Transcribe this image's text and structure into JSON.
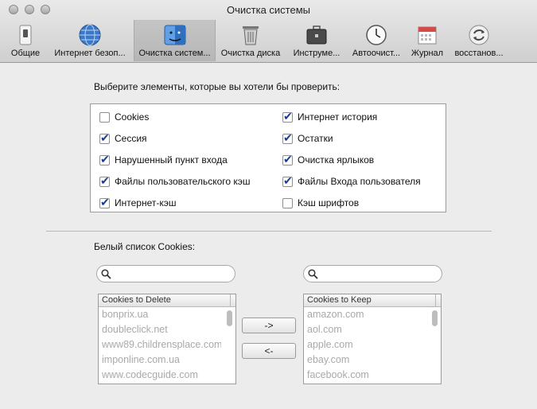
{
  "window": {
    "title": "Очистка системы"
  },
  "toolbar": {
    "items": [
      {
        "label": "Общие",
        "icon": "switch-icon"
      },
      {
        "label": "Интернет безоп...",
        "icon": "globe-icon"
      },
      {
        "label": "Очистка систем...",
        "icon": "finder-icon"
      },
      {
        "label": "Очистка диска",
        "icon": "trash-icon"
      },
      {
        "label": "Инструме...",
        "icon": "toolbox-icon"
      },
      {
        "label": "Автоочист...",
        "icon": "clock-icon"
      },
      {
        "label": "Журнал",
        "icon": "calendar-icon"
      },
      {
        "label": "восстанов...",
        "icon": "restore-icon"
      }
    ]
  },
  "selection": {
    "prompt": "Выберите элементы, которые вы хотели бы проверить:",
    "left": [
      {
        "label": "Cookies",
        "checked": false
      },
      {
        "label": "Сессия",
        "checked": true
      },
      {
        "label": "Нарушенный пункт входа",
        "checked": true
      },
      {
        "label": "Файлы пользовательского кэш",
        "checked": true
      },
      {
        "label": "Интернет-кэш",
        "checked": true
      }
    ],
    "right": [
      {
        "label": "Интернет история",
        "checked": true
      },
      {
        "label": "Остатки",
        "checked": true
      },
      {
        "label": "Очистка ярлыков",
        "checked": true
      },
      {
        "label": "Файлы Входа пользователя",
        "checked": true
      },
      {
        "label": "Кэш шрифтов",
        "checked": false
      }
    ]
  },
  "whitelist": {
    "label": "Белый список Cookies:",
    "delete_header": "Cookies to Delete",
    "keep_header": "Cookies to Keep",
    "delete_items": [
      "bonprix.ua",
      "doubleclick.net",
      "www89.childrensplace.com",
      "imponline.com.ua",
      "www.codecguide.com"
    ],
    "keep_items": [
      "amazon.com",
      "aol.com",
      "apple.com",
      "ebay.com",
      "facebook.com"
    ],
    "move_right_label": "->",
    "move_left_label": "<-"
  }
}
